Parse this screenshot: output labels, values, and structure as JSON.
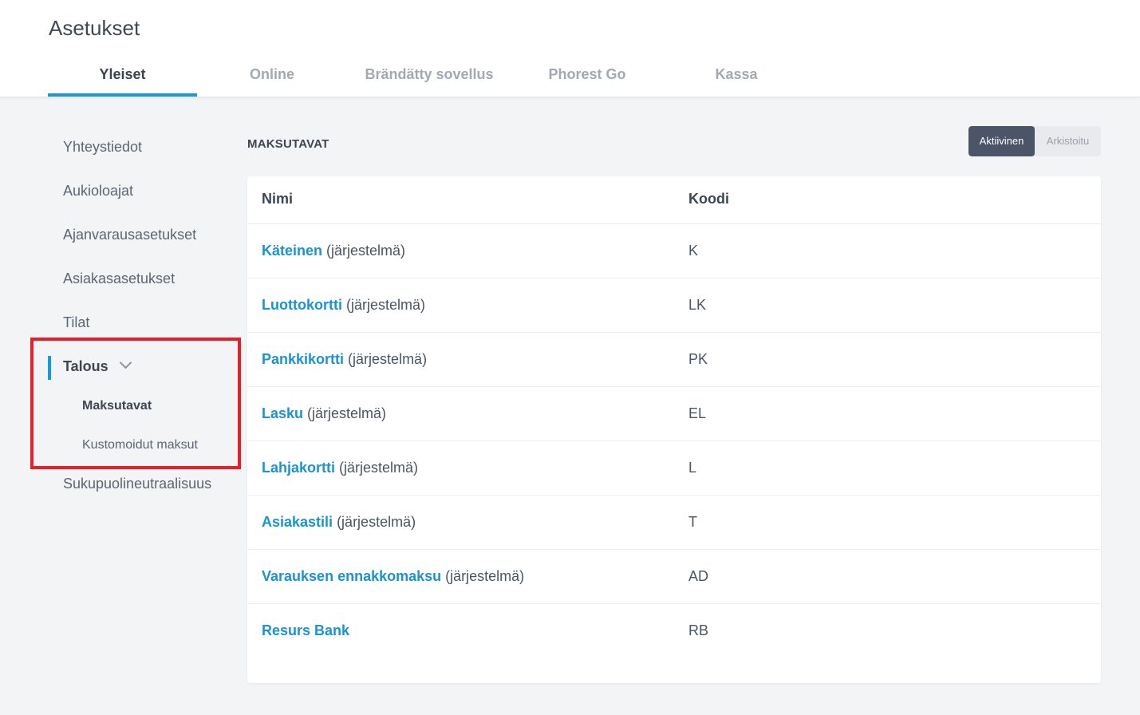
{
  "page": {
    "title": "Asetukset"
  },
  "tabs": [
    {
      "label": "Yleiset",
      "active": true
    },
    {
      "label": "Online"
    },
    {
      "label": "Brändätty sovellus"
    },
    {
      "label": "Phorest Go"
    },
    {
      "label": "Kassa"
    }
  ],
  "sidebar": {
    "items": [
      {
        "label": "Yhteystiedot"
      },
      {
        "label": "Aukioloajat"
      },
      {
        "label": "Ajanvarausasetukset"
      },
      {
        "label": "Asiakasasetukset"
      },
      {
        "label": "Tilat"
      },
      {
        "label": "Talous",
        "expanded": true
      },
      {
        "label": "Sukupuolineutraalisuus"
      }
    ],
    "subitems": [
      {
        "label": "Maksutavat",
        "active": true
      },
      {
        "label": "Kustomoidut maksut"
      }
    ]
  },
  "section": {
    "title": "MAKSUTAVAT",
    "toggle": {
      "active_label": "Aktiivinen",
      "archived_label": "Arkistoitu",
      "selected": "Aktiivinen"
    }
  },
  "table": {
    "headers": {
      "name": "Nimi",
      "code": "Koodi"
    },
    "rows": [
      {
        "name": "Käteinen",
        "suffix": "(järjestelmä)",
        "code": "K"
      },
      {
        "name": "Luottokortti",
        "suffix": "(järjestelmä)",
        "code": "LK"
      },
      {
        "name": "Pankkikortti",
        "suffix": "(järjestelmä)",
        "code": "PK"
      },
      {
        "name": "Lasku",
        "suffix": "(järjestelmä)",
        "code": "EL"
      },
      {
        "name": "Lahjakortti",
        "suffix": "(järjestelmä)",
        "code": "L"
      },
      {
        "name": "Asiakastili",
        "suffix": "(järjestelmä)",
        "code": "T"
      },
      {
        "name": "Varauksen ennakkomaksu",
        "suffix": "(järjestelmä)",
        "code": "AD"
      },
      {
        "name": "Resurs Bank",
        "suffix": "",
        "code": "RB"
      }
    ]
  },
  "colors": {
    "accent": "#1a9ad6",
    "link": "#1a93cf",
    "highlight": "#e3212a",
    "toggle_active_bg": "#4c5568"
  }
}
